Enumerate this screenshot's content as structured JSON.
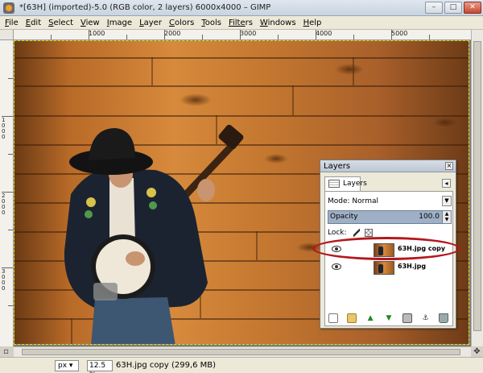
{
  "window": {
    "title": "*[63H] (imported)-5.0 (RGB color, 2 layers) 6000x4000 – GIMP",
    "controls": {
      "minimize": "–",
      "maximize": "□",
      "close": "✕"
    }
  },
  "menubar": {
    "items": [
      {
        "first": "F",
        "rest": "ile"
      },
      {
        "first": "E",
        "rest": "dit"
      },
      {
        "first": "S",
        "rest": "elect"
      },
      {
        "first": "V",
        "rest": "iew"
      },
      {
        "first": "I",
        "rest": "mage"
      },
      {
        "first": "L",
        "rest": "ayer"
      },
      {
        "first": "C",
        "rest": "olors"
      },
      {
        "first": "T",
        "rest": "ools"
      },
      {
        "first": "Filte",
        "rest": "rs"
      },
      {
        "first": "W",
        "rest": "indows"
      },
      {
        "first": "H",
        "rest": "elp"
      }
    ]
  },
  "rulers": {
    "top_labels": [
      "1000",
      "2000",
      "3000",
      "4000",
      "5000"
    ],
    "left_labels": [
      "1000",
      "2000",
      "3000"
    ]
  },
  "statusbar": {
    "unit": "px",
    "zoom": "12.5 %",
    "message": "63H.jpg copy (299,6 MB)"
  },
  "layers_dock": {
    "title": "Layers",
    "tab_label": "Layers",
    "mode_label": "Mode: Normal",
    "opacity_label": "Opacity",
    "opacity_value": "100.0",
    "lock_label": "Lock:",
    "layers": [
      {
        "name": "63H.jpg copy"
      },
      {
        "name": "63H.jpg"
      }
    ]
  },
  "colors": {
    "annotation": "#b3181c",
    "selection_row": "#9fb0c6"
  }
}
